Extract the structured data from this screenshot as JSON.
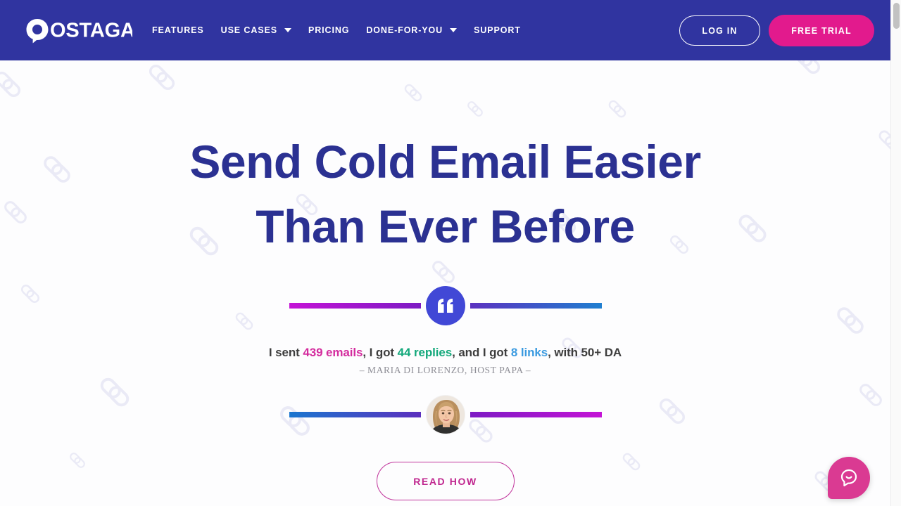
{
  "header": {
    "logo_text": "POSTAGA",
    "logo_icon": "speech-bubble-p-logo",
    "background_color": "#3034a0",
    "nav": [
      {
        "label": "FEATURES",
        "has_dropdown": false
      },
      {
        "label": "USE CASES",
        "has_dropdown": true
      },
      {
        "label": "PRICING",
        "has_dropdown": false
      },
      {
        "label": "DONE-FOR-YOU",
        "has_dropdown": true
      },
      {
        "label": "SUPPORT",
        "has_dropdown": false
      }
    ],
    "login_label": "LOG IN",
    "trial_label": "FREE TRIAL",
    "trial_color": "#e21a8d"
  },
  "hero": {
    "title": "Send Cold Email Easier Than Ever Before",
    "title_color": "#2b3192",
    "quote_icon": "quote-mark-icon",
    "quote_circle_color": "#4148d6",
    "avatar_icon": "user-avatar-photo",
    "testimonial": {
      "part1": "I sent ",
      "emails": "439 emails",
      "part2": ", I got ",
      "replies": "44 replies",
      "part3": ", and I got ",
      "links": "8 links",
      "part4": ", with 50+ DA",
      "emails_color": "#d42c9e",
      "replies_color": "#13a87b",
      "links_color": "#3a9ae0"
    },
    "attribution": "– MARIA DI LORENZO, HOST PAPA –",
    "cta_label": "READ HOW",
    "cta_color": "#c0278f"
  },
  "chat": {
    "icon": "chat-bubble-smile-icon",
    "color": "#da3a92"
  },
  "scrollbar": {
    "thumb_color": "#c2c2c2"
  }
}
